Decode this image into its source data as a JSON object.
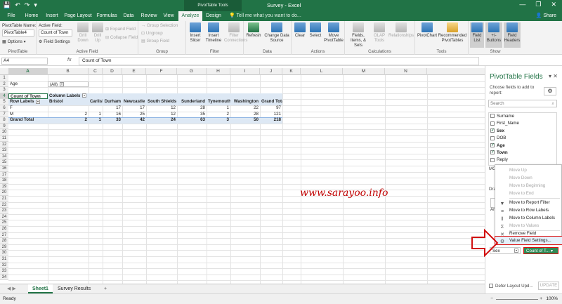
{
  "titlebar": {
    "tools_label": "PivotTable Tools",
    "window_title": "Survey - Excel",
    "minimize": "—",
    "restore": "❐",
    "close": "✕",
    "save": "💾",
    "undo": "↶",
    "redo": "↷",
    "qat_more": "▾"
  },
  "tabs": {
    "file": "File",
    "home": "Home",
    "insert": "Insert",
    "page_layout": "Page Layout",
    "formulas": "Formulas",
    "data": "Data",
    "review": "Review",
    "view": "View",
    "analyze": "Analyze",
    "design": "Design",
    "tell_me": "Tell me what you want to do...",
    "share": "Share"
  },
  "ribbon": {
    "pivot_name_label": "PivotTable Name:",
    "pivot_name_value": "PivotTable4",
    "options": "Options",
    "pivottable_group": "PivotTable",
    "active_field_label": "Active Field:",
    "active_field_value": "Count of Town",
    "field_settings": "Field Settings",
    "drill_down": "Drill Down",
    "drill_up": "Drill Up",
    "expand_field": "Expand Field",
    "collapse_field": "Collapse Field",
    "active_field_group": "Active Field",
    "group_selection": "Group Selection",
    "ungroup": "Ungroup",
    "group_field": "Group Field",
    "group_group": "Group",
    "insert_slicer": "Insert Slicer",
    "insert_timeline": "Insert Timeline",
    "filter_connections": "Filter Connections",
    "filter_group": "Filter",
    "refresh": "Refresh",
    "change_data_source": "Change Data Source",
    "data_group": "Data",
    "clear": "Clear",
    "select": "Select",
    "move_pivottable": "Move PivotTable",
    "actions_group": "Actions",
    "fields_items_sets": "Fields, Items, & Sets",
    "olap_tools": "OLAP Tools",
    "relationships": "Relationships",
    "calculations_group": "Calculations",
    "pivotchart": "PivotChart",
    "recommended_pivottables": "Recommended PivotTables",
    "tools_group": "Tools",
    "field_list": "Field List",
    "buttons": "+/- Buttons",
    "field_headers": "Field Headers",
    "show_group": "Show"
  },
  "formula_bar": {
    "name_box": "A4",
    "fx": "fx",
    "formula": "Count of Town"
  },
  "grid": {
    "columns": [
      "A",
      "B",
      "C",
      "D",
      "E",
      "F",
      "G",
      "H",
      "I",
      "J",
      "K",
      "L",
      "M",
      "N"
    ],
    "rows": [
      "1",
      "2",
      "3",
      "4",
      "5",
      "6",
      "7",
      "8",
      "9",
      "10",
      "11",
      "12",
      "13",
      "14",
      "15",
      "16",
      "17",
      "18",
      "19",
      "20",
      "21",
      "22",
      "23",
      "24",
      "25",
      "26",
      "27",
      "28",
      "29",
      "30",
      "31",
      "32",
      "33",
      "34"
    ],
    "filter_label": "Age",
    "filter_value": "(All)",
    "values_label": "Count of Town",
    "column_labels": "Column Labels",
    "row_labels": "Row Labels",
    "headers": [
      "Bristol",
      "Carlisle",
      "Durham",
      "Newcastle",
      "South Shields",
      "Sunderland",
      "Tynemouth",
      "Washington",
      "Grand Total"
    ],
    "data_rows": [
      {
        "label": "F",
        "values": [
          "",
          "",
          "17",
          "17",
          "12",
          "28",
          "1",
          "22",
          "97"
        ]
      },
      {
        "label": "M",
        "values": [
          "2",
          "1",
          "16",
          "25",
          "12",
          "35",
          "2",
          "28",
          "121"
        ]
      }
    ],
    "total_row": {
      "label": "Grand Total",
      "values": [
        "2",
        "1",
        "33",
        "42",
        "24",
        "63",
        "3",
        "50",
        "218"
      ]
    }
  },
  "watermark": "www.sarayoo.info",
  "sheets": {
    "sheet1": "Sheet1",
    "survey_results": "Survey Results",
    "add": "+"
  },
  "status": {
    "ready": "Ready",
    "zoom": "100%",
    "zoom_minus": "−",
    "zoom_plus": "+"
  },
  "pane": {
    "title": "PivotTable Fields",
    "pin": "▾",
    "close": "✕",
    "choose": "Choose fields to add to report:",
    "gear": "⚙",
    "search_placeholder": "Search",
    "search_icon": "⌕",
    "fields": [
      {
        "name": "Surname",
        "checked": false,
        "bold": false
      },
      {
        "name": "First_Name",
        "checked": false,
        "bold": false
      },
      {
        "name": "Sex",
        "checked": true,
        "bold": true
      },
      {
        "name": "DOB",
        "checked": false,
        "bold": false
      },
      {
        "name": "Age",
        "checked": true,
        "bold": true
      },
      {
        "name": "Town",
        "checked": true,
        "bold": true
      },
      {
        "name": "Reply",
        "checked": false,
        "bold": false
      }
    ],
    "mo_label": "MO",
    "dr_label": "Dra",
    "ar_label": "Ar",
    "rows_field": "Sex",
    "values_field": "Count of T...",
    "defer_label": "Defer Layout Upd...",
    "update": "UPDATE"
  },
  "context_menu": {
    "move_up": "Move Up",
    "move_down": "Move Down",
    "move_beginning": "Move to Beginning",
    "move_end": "Move to End",
    "move_report_filter": "Move to Report Filter",
    "move_row_labels": "Move to Row Labels",
    "move_column_labels": "Move to Column Labels",
    "move_values": "Move to Values",
    "remove_field": "Remove Field",
    "value_field_settings": "Value Field Settings..."
  },
  "colors": {
    "excel_green": "#217346",
    "highlight_red": "#d11111",
    "pivot_band": "#dde8f4"
  }
}
